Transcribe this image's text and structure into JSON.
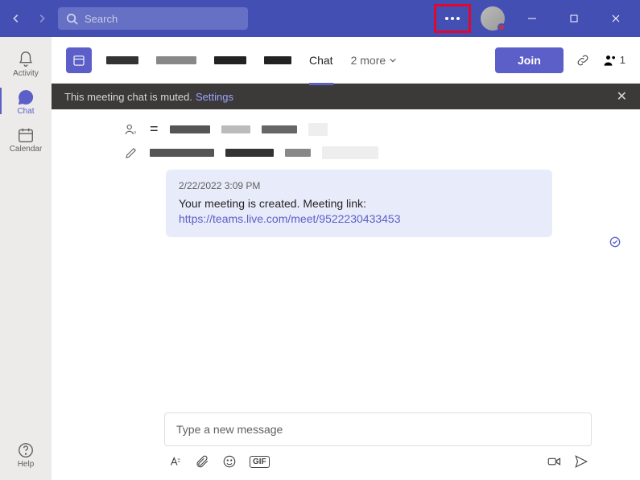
{
  "titlebar": {
    "search_placeholder": "Search"
  },
  "rail": {
    "activity": "Activity",
    "chat": "Chat",
    "calendar": "Calendar",
    "help": "Help"
  },
  "chat_header": {
    "active_tab": "Chat",
    "more_label": "2 more",
    "join_label": "Join",
    "people_count": "1"
  },
  "banner": {
    "text": "This meeting chat is muted.",
    "link": "Settings"
  },
  "message": {
    "timestamp": "2/22/2022 3:09 PM",
    "body": "Your meeting is created. Meeting link:",
    "link": "https://teams.live.com/meet/9522230433453"
  },
  "compose": {
    "placeholder": "Type a new message",
    "gif": "GIF"
  }
}
